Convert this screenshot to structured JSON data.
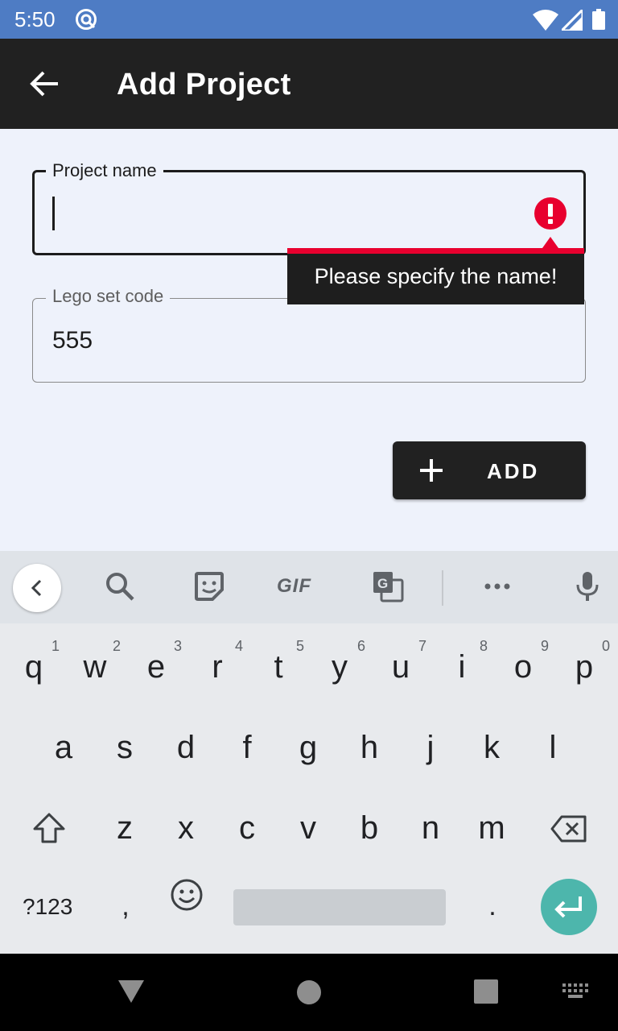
{
  "status_bar": {
    "time": "5:50"
  },
  "app_bar": {
    "title": "Add Project"
  },
  "form": {
    "project_name": {
      "label": "Project name",
      "value": ""
    },
    "error_message": "Please specify the name!",
    "lego_set_code": {
      "label": "Lego set code",
      "value": "555"
    },
    "add_button_label": "ADD"
  },
  "keyboard": {
    "toolbar": {
      "gif_label": "GIF"
    },
    "row1": [
      {
        "ch": "q",
        "sup": "1"
      },
      {
        "ch": "w",
        "sup": "2"
      },
      {
        "ch": "e",
        "sup": "3"
      },
      {
        "ch": "r",
        "sup": "4"
      },
      {
        "ch": "t",
        "sup": "5"
      },
      {
        "ch": "y",
        "sup": "6"
      },
      {
        "ch": "u",
        "sup": "7"
      },
      {
        "ch": "i",
        "sup": "8"
      },
      {
        "ch": "o",
        "sup": "9"
      },
      {
        "ch": "p",
        "sup": "0"
      }
    ],
    "row2": [
      "a",
      "s",
      "d",
      "f",
      "g",
      "h",
      "j",
      "k",
      "l"
    ],
    "row3": [
      "z",
      "x",
      "c",
      "v",
      "b",
      "n",
      "m"
    ],
    "row4": {
      "symbols": "?123",
      "comma": ",",
      "period": "."
    }
  },
  "colors": {
    "status_bar": "#4e7cc4",
    "app_bar": "#212121",
    "background": "#eef2fb",
    "error": "#e8002e",
    "enter_key": "#4db6ac"
  },
  "icons": {
    "back": "arrow-left-icon",
    "error": "exclamation-circle-icon",
    "add": "plus-icon",
    "enter": "return-icon"
  }
}
